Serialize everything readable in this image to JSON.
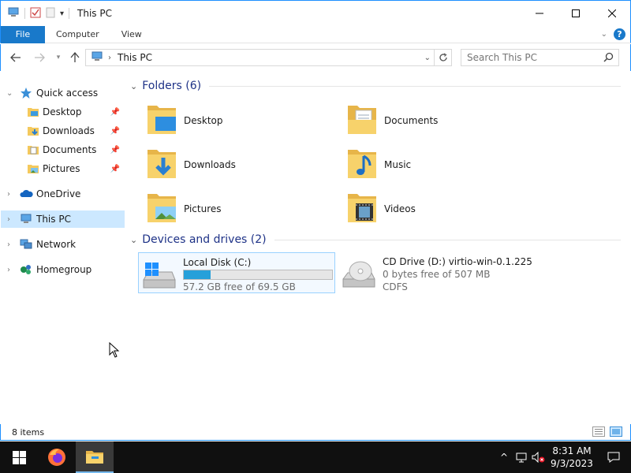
{
  "window": {
    "title": "This PC"
  },
  "ribbon": {
    "tabs": [
      "File",
      "Computer",
      "View"
    ],
    "help": "?"
  },
  "address": {
    "path": "This PC",
    "search_placeholder": "Search This PC"
  },
  "nav": {
    "quick_access": "Quick access",
    "quick_items": [
      "Desktop",
      "Downloads",
      "Documents",
      "Pictures"
    ],
    "onedrive": "OneDrive",
    "this_pc": "This PC",
    "network": "Network",
    "homegroup": "Homegroup"
  },
  "folders": {
    "header": "Folders (6)",
    "items": [
      "Desktop",
      "Documents",
      "Downloads",
      "Music",
      "Pictures",
      "Videos"
    ]
  },
  "drives": {
    "header": "Devices and drives (2)",
    "items": [
      {
        "name": "Local Disk (C:)",
        "free": "57.2 GB free of 69.5 GB",
        "used_fraction": 0.18
      },
      {
        "name": "CD Drive (D:) virtio-win-0.1.225",
        "free": "0 bytes free of 507 MB",
        "fs": "CDFS"
      }
    ]
  },
  "status": {
    "items": "8 items"
  },
  "taskbar": {
    "time": "8:31 AM",
    "date": "9/3/2023"
  },
  "colors": {
    "accent": "#1979ca",
    "selection": "#cce8ff",
    "group_header": "#1e3287",
    "taskbar": "#101010"
  }
}
